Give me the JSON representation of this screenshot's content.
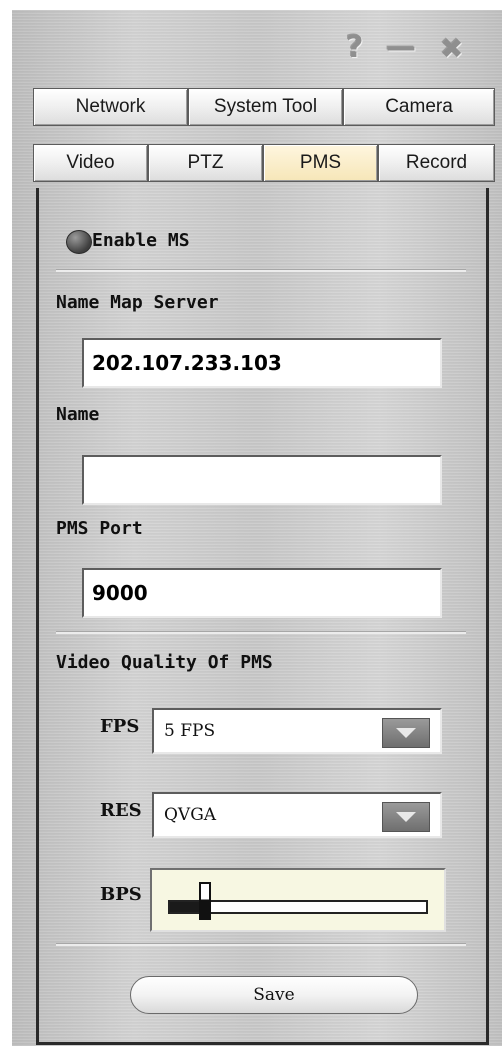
{
  "window": {
    "help_glyph": "?",
    "minimize_glyph": "—",
    "close_glyph": "✖"
  },
  "tabs_row1": [
    "Network",
    "System Tool",
    "Camera"
  ],
  "tabs_row2": [
    "Video",
    "PTZ",
    "PMS",
    "Record"
  ],
  "active_tab": "PMS",
  "enable": {
    "label": "Enable MS",
    "enabled": false
  },
  "server": {
    "label": "Name Map Server",
    "value": "202.107.233.103"
  },
  "name": {
    "label": "Name",
    "value": ""
  },
  "port": {
    "label": "PMS Port",
    "value": "9000"
  },
  "quality": {
    "label": "Video Quality Of PMS",
    "fps_label": "FPS",
    "fps_value": "5 FPS",
    "res_label": "RES",
    "res_value": "QVGA",
    "bps_label": "BPS",
    "bps_level": 0.12
  },
  "save_label": "Save",
  "colors": {
    "active_tab": "#f6e6b8",
    "panel": "#c8c8c8",
    "bps_bg": "#f7f7e2"
  }
}
